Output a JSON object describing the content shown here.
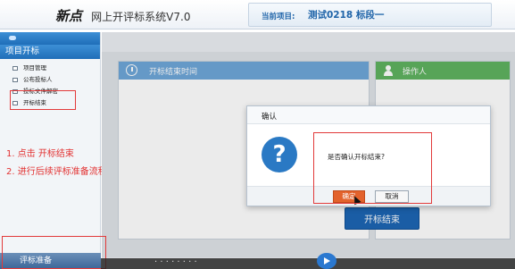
{
  "header": {
    "brand": "新点",
    "system_name": "网上开评标系统V7.0",
    "project_label": "当前项目:",
    "project_value": "测试0218 标段一"
  },
  "sidebar": {
    "title": "项目开标",
    "items": [
      {
        "label": "项目管理"
      },
      {
        "label": "公布投标人"
      },
      {
        "label": "投标文件解密"
      },
      {
        "label": "开标结束"
      }
    ],
    "bottom_label": "评标准备"
  },
  "annotations": {
    "step1": "1. 点击  开标结束",
    "step2": "2. 进行后续评标准备流程"
  },
  "main": {
    "left_panel_title": "开标结束时间",
    "right_panel_title": "操作人",
    "open_end_button": "开标结束"
  },
  "dialog": {
    "title": "确认",
    "message": "是否确认开标结束?",
    "ok_label": "确定",
    "cancel_label": "取消"
  },
  "video_overlay": {
    "text": "· ·  ·  ·  ·  ·  ·  ·"
  },
  "colors": {
    "accent_blue": "#1d65b3",
    "annotation_red": "#e23030",
    "ok_orange": "#e3622c",
    "green_panel": "#5fb260"
  },
  "icons": [
    "clock-icon",
    "person-icon",
    "question-icon",
    "checkbox-icon",
    "play-icon"
  ]
}
